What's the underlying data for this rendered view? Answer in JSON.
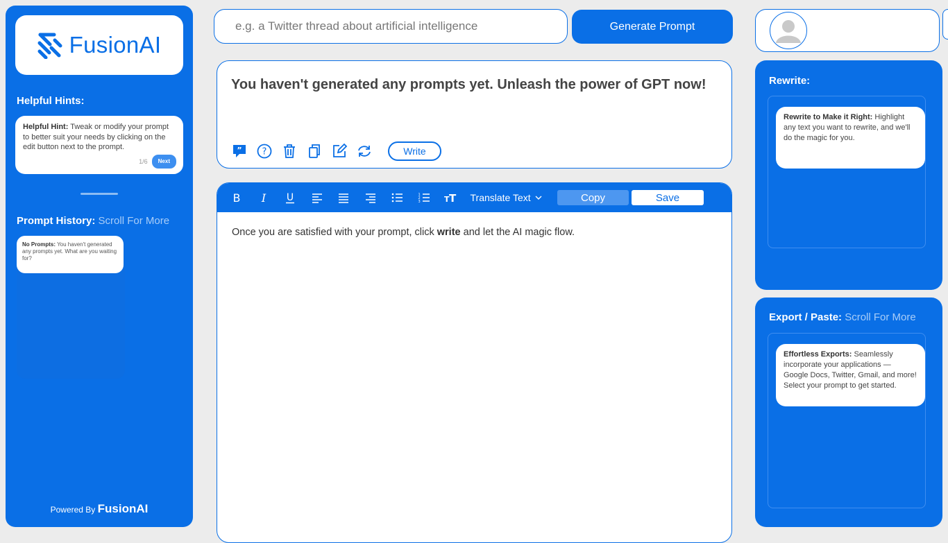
{
  "sidebar": {
    "logo_text": "FusionAI",
    "hints_title": "Helpful Hints:",
    "hint": {
      "label": "Helpful Hint:",
      "text": " Tweak or modify your prompt to better suit your needs by clicking on the edit button next to the prompt.",
      "counter": "1/6",
      "next_label": "Next"
    },
    "history_title": "Prompt History:",
    "history_scroll": "Scroll For More",
    "history_card": {
      "label": "No Prompts:",
      "text": " You haven't generated any prompts yet. What are you waiting for?"
    },
    "powered_by": "Powered By",
    "powered_brand": "FusionAI"
  },
  "search": {
    "placeholder": "e.g. a Twitter thread about artificial intelligence"
  },
  "generate_button": "Generate Prompt",
  "prompt_panel": {
    "message": "You haven't generated any prompts yet. Unleash the power of GPT now!",
    "write_label": "Write"
  },
  "editor": {
    "translate_label": "Translate Text",
    "copy_label": "Copy",
    "save_label": "Save",
    "body_pre": "Once you are satisfied with your prompt, click ",
    "body_bold": "write",
    "body_post": " and let the AI magic flow."
  },
  "rewrite_panel": {
    "title": "Rewrite:",
    "card_label": "Rewrite to Make it Right:",
    "card_text": " Highlight any text you want to rewrite, and we'll do the magic for you."
  },
  "export_panel": {
    "title": "Export / Paste:",
    "scroll": "Scroll For More",
    "card_label": "Effortless Exports:",
    "card_text": " Seamlessly incorporate your applications — Google Docs, Twitter, Gmail, and more! Select your prompt to get started."
  },
  "colors": {
    "primary": "#0a6fe6",
    "background": "#ececec",
    "muted_text": "#a9cdf8"
  }
}
